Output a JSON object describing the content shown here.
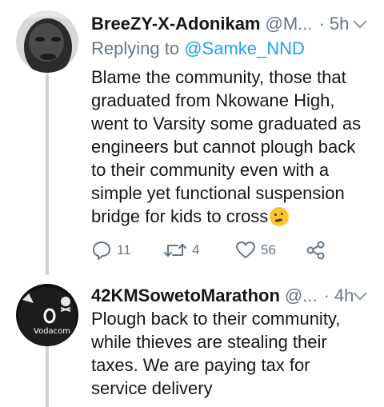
{
  "tweets": [
    {
      "display_name": "BreeZY-X-Adonikam",
      "handle": "@M...",
      "separator": "·",
      "time": "5h",
      "reply_prefix": "Replying to",
      "reply_to": "@Samke_NND",
      "text": "Blame the community, those that graduated from Nkowane High, went to Varsity some graduated as engineers but cannot plough back to their community even with a simple yet functional suspension bridge for kids to cross",
      "emoji": "thinking-face-icon",
      "actions": {
        "reply_count": "11",
        "retweet_count": "4",
        "like_count": "56"
      }
    },
    {
      "display_name": "42KMSowetoMarathon",
      "handle": "@...",
      "separator": "·",
      "time": "4h",
      "text": "Plough back to their community, while thieves are stealing their taxes. We are paying tax for service delivery"
    }
  ],
  "colors": {
    "primary_text": "#14171a",
    "secondary_text": "#657786",
    "link": "#1da1f2",
    "thread_line": "#c9d3db"
  }
}
